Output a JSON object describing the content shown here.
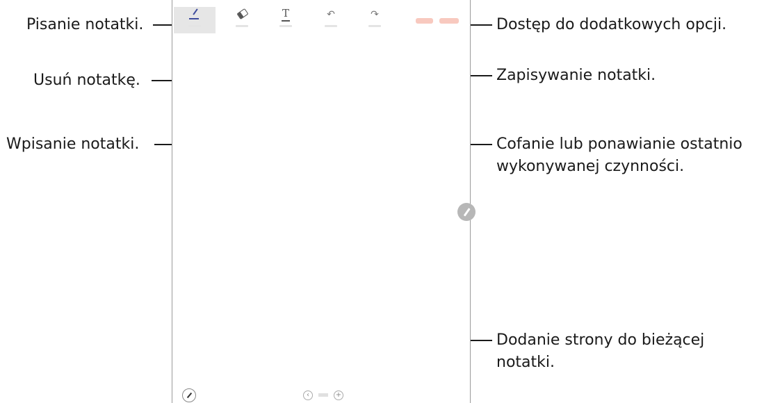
{
  "callouts": {
    "write": "Pisanie notatki.",
    "erase": "Usuń notatkę.",
    "type": "Wpisanie notatki.",
    "options": "Dostęp do dodatkowych opcji.",
    "save": "Zapisywanie notatki.",
    "undo_redo_line1": "Cofanie lub ponawianie ostatnio",
    "undo_redo_line2": "wykonywanej czynności.",
    "add_page_line1": "Dodanie strony do bieżącej",
    "add_page_line2": "notatki."
  },
  "toolbar": {
    "undo_glyph": "↶",
    "redo_glyph": "↷",
    "text_glyph": "T"
  },
  "pager": {
    "prev_glyph": "‹",
    "add_glyph": "+"
  },
  "colors": {
    "pen_accent": "#3d4b9c",
    "save_accent": "#f8c9bf"
  }
}
